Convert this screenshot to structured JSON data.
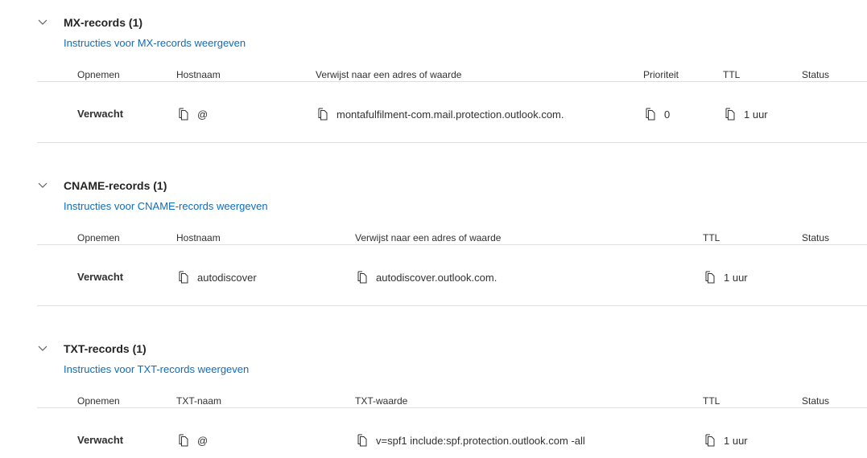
{
  "sections": [
    {
      "title": "MX-records (1)",
      "instructions": "Instructies voor MX-records weergeven",
      "headers": {
        "record": "Opnemen",
        "name": "Hostnaam",
        "value": "Verwijst naar een adres of waarde",
        "priority": "Prioriteit",
        "ttl": "TTL",
        "status": "Status"
      },
      "row": {
        "record": "Verwacht",
        "name": "@",
        "value": "montafulfilment-com.mail.protection.outlook.com.",
        "priority": "0",
        "ttl": "1 uur"
      }
    },
    {
      "title": "CNAME-records (1)",
      "instructions": "Instructies voor CNAME-records weergeven",
      "headers": {
        "record": "Opnemen",
        "name": "Hostnaam",
        "value": "Verwijst naar een adres of waarde",
        "ttl": "TTL",
        "status": "Status"
      },
      "row": {
        "record": "Verwacht",
        "name": "autodiscover",
        "value": "autodiscover.outlook.com.",
        "ttl": "1 uur"
      }
    },
    {
      "title": "TXT-records (1)",
      "instructions": "Instructies voor TXT-records weergeven",
      "headers": {
        "record": "Opnemen",
        "name": "TXT-naam",
        "value": "TXT-waarde",
        "ttl": "TTL",
        "status": "Status"
      },
      "row": {
        "record": "Verwacht",
        "name": "@",
        "value": "v=spf1 include:spf.protection.outlook.com -all",
        "ttl": "1 uur"
      }
    }
  ],
  "icons": {
    "chevron": "chevron-down-icon",
    "copy": "copy-icon"
  },
  "colors": {
    "link": "#0f6cbd",
    "divider": "#e1dfdd",
    "text": "#323130"
  }
}
